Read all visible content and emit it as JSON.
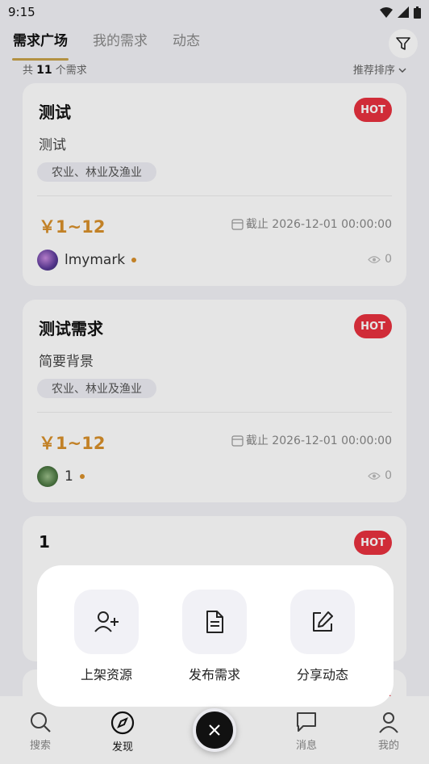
{
  "status": {
    "time": "9:15"
  },
  "tabs": [
    {
      "label": "需求广场"
    },
    {
      "label": "我的需求"
    },
    {
      "label": "动态"
    }
  ],
  "list": {
    "count_prefix": "共",
    "count": "11",
    "count_suffix": "个需求",
    "sort_label": "推荐排序"
  },
  "cards": [
    {
      "title": "测试",
      "hot": "HOT",
      "desc": "测试",
      "tag": "农业、林业及渔业",
      "price": "￥1~12",
      "deadline": "截止 2026-12-01 00:00:00",
      "author": "lmymark",
      "views": "0"
    },
    {
      "title": "测试需求",
      "hot": "HOT",
      "desc": "简要背景",
      "tag": "农业、林业及渔业",
      "price": "￥1~12",
      "deadline": "截止 2026-12-01 00:00:00",
      "author": "1",
      "views": "0"
    },
    {
      "title": "1",
      "hot": "HOT"
    }
  ],
  "popup": {
    "actions": [
      {
        "label": "上架资源",
        "icon": "user-plus-icon"
      },
      {
        "label": "发布需求",
        "icon": "document-icon"
      },
      {
        "label": "分享动态",
        "icon": "edit-icon"
      }
    ]
  },
  "nav": [
    {
      "label": "搜索",
      "icon": "search-icon"
    },
    {
      "label": "发现",
      "icon": "compass-icon"
    },
    {
      "label": "消息",
      "icon": "message-icon"
    },
    {
      "label": "我的",
      "icon": "user-icon"
    }
  ],
  "colors": {
    "accent": "#c8a24a",
    "price": "#d9902b",
    "hot": "#e8323f"
  }
}
